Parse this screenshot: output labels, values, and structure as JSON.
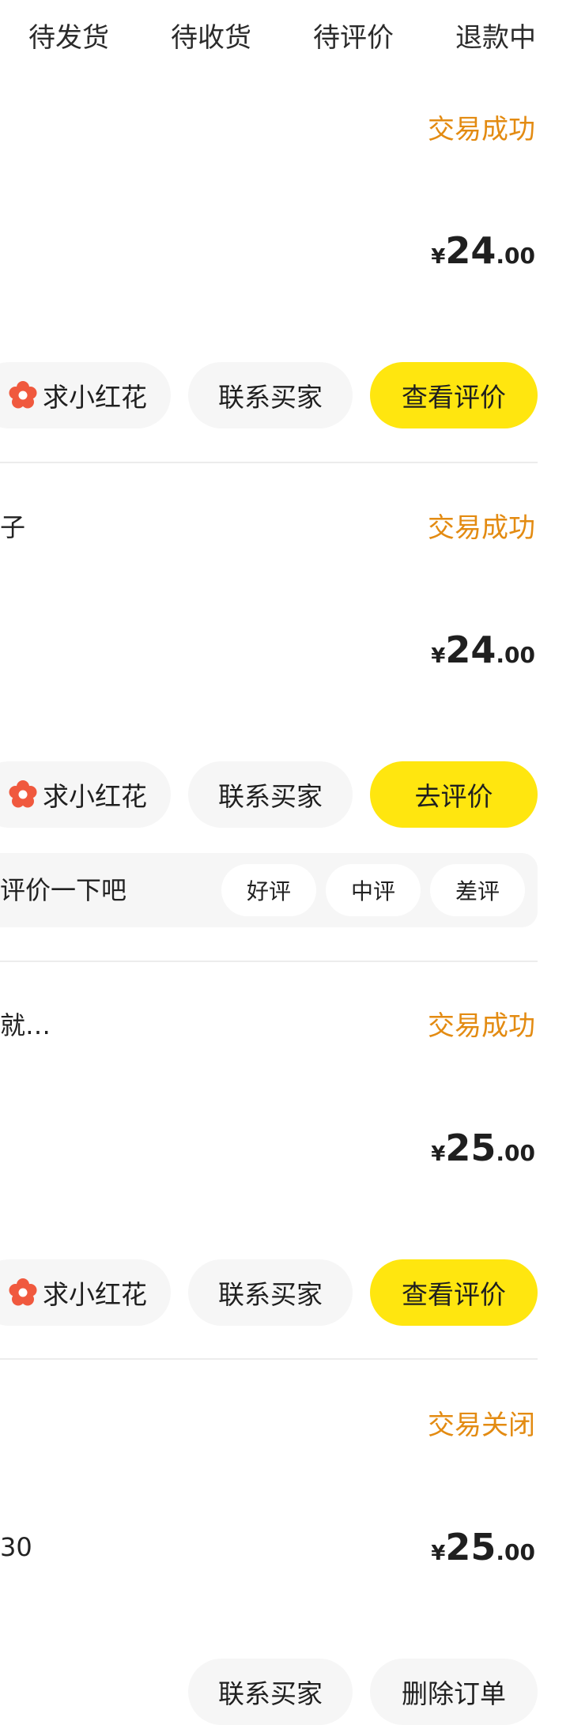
{
  "tabs": [
    {
      "label": "待发货"
    },
    {
      "label": "待收货"
    },
    {
      "label": "待评价"
    },
    {
      "label": "退款中"
    }
  ],
  "colors": {
    "status": "#e38b12",
    "primary_button": "#ffe60f",
    "secondary_button": "#f6f6f6",
    "flower": "#f0593e"
  },
  "orders": [
    {
      "title": "",
      "status": "交易成功",
      "subtext": "",
      "price": {
        "currency": "¥",
        "integer": "24",
        "decimal": ".00"
      },
      "flower_label": "求小红花",
      "contact_label": "联系买家",
      "action_label": "查看评价"
    },
    {
      "title": "子",
      "status": "交易成功",
      "subtext": "",
      "price": {
        "currency": "¥",
        "integer": "24",
        "decimal": ".00"
      },
      "flower_label": "求小红花",
      "contact_label": "联系买家",
      "action_label": "去评价",
      "review": {
        "prompt": "评价一下吧",
        "options": [
          "好评",
          "中评",
          "差评"
        ]
      }
    },
    {
      "title": "就…",
      "status": "交易成功",
      "subtext": "",
      "price": {
        "currency": "¥",
        "integer": "25",
        "decimal": ".00"
      },
      "flower_label": "求小红花",
      "contact_label": "联系买家",
      "action_label": "查看评价"
    },
    {
      "title": "",
      "status": "交易关闭",
      "subtext": "30",
      "price": {
        "currency": "¥",
        "integer": "25",
        "decimal": ".00"
      },
      "contact_label": "联系买家",
      "action_label": "删除订单"
    }
  ]
}
